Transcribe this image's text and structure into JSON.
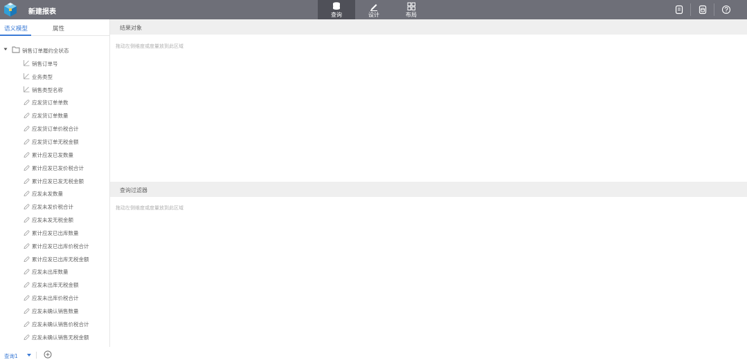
{
  "app": {
    "title": "新建报表"
  },
  "modes": [
    {
      "label": "查询",
      "icon": "database-icon",
      "active": true
    },
    {
      "label": "设计",
      "icon": "pencil-icon",
      "active": false
    },
    {
      "label": "布局",
      "icon": "grid-icon",
      "active": false
    }
  ],
  "header_actions": [
    "document-icon",
    "data-source-icon",
    "help-icon"
  ],
  "left_panel": {
    "tabs": [
      "语义模型",
      "属性"
    ],
    "active_tab": "语义模型",
    "root": "销售订单履约全状态",
    "dimensions": [
      "销售订单号",
      "业务类型",
      "销售类型名称"
    ],
    "measures": [
      "应发货订单单数",
      "应发货订单数量",
      "应发货订单价税合计",
      "应发货订单无税金额",
      "累计应发已发数量",
      "累计应发已发价税合计",
      "累计应发已发无税金额",
      "应发未发数量",
      "应发未发价税合计",
      "应发未发无税金额",
      "累计应发已出库数量",
      "累计应发已出库价税合计",
      "累计应发已出库无税金额",
      "应发未出库数量",
      "应发未出库无税金额",
      "应发未出库价税合计",
      "应发未确认销售数量",
      "应发未确认销售价税合计",
      "应发未确认销售无税金额"
    ]
  },
  "result_pane": {
    "title": "结果对象",
    "hint": "拖动左侧维度或度量放到此区域"
  },
  "filter_pane": {
    "title": "查询过滤器",
    "hint": "拖动左侧维度或度量放到此区域"
  },
  "bottom": {
    "query_tab": "查询1"
  },
  "colors": {
    "topbar": "#6e6f78",
    "active_mode": "#4f5058",
    "accent": "#3a7ad5",
    "pane_header": "#efefef"
  }
}
